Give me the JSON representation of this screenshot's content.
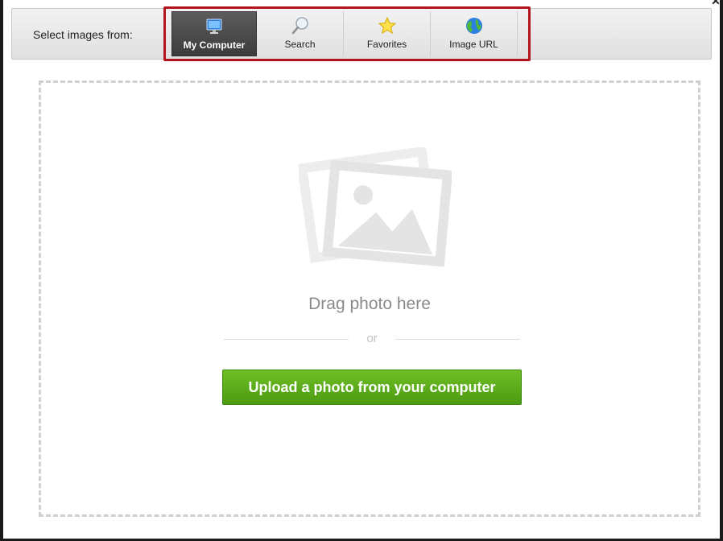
{
  "toolbar": {
    "label": "Select images from:",
    "tabs": [
      {
        "label": "My Computer",
        "icon": "monitor-icon",
        "active": true
      },
      {
        "label": "Search",
        "icon": "magnifier-icon",
        "active": false
      },
      {
        "label": "Favorites",
        "icon": "star-icon",
        "active": false
      },
      {
        "label": "Image URL",
        "icon": "globe-icon",
        "active": false
      }
    ]
  },
  "drop_zone": {
    "icon": "photo-stack-icon",
    "drag_text": "Drag photo here",
    "or_text": "or",
    "upload_label": "Upload a photo from your computer"
  },
  "colors": {
    "highlight_border": "#b3151d",
    "upload_button": "#5aab1a",
    "active_tab": "#4a4a4a"
  }
}
